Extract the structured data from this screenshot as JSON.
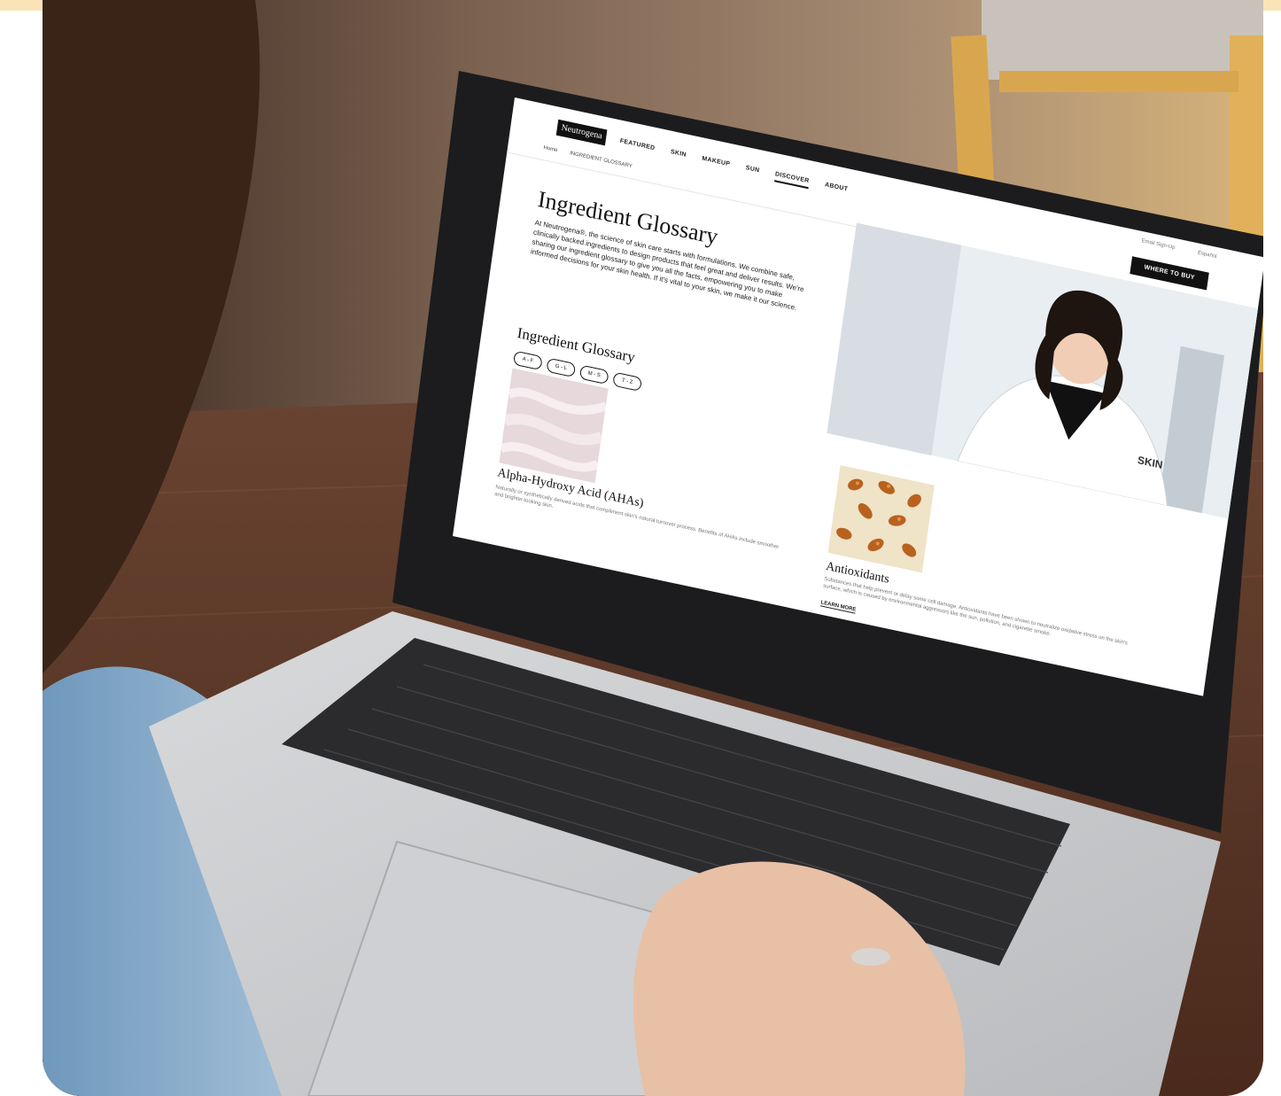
{
  "colors": {
    "accent_band": "#fbe3b8",
    "screen_background": "#ffffff",
    "button": "#111111"
  },
  "site": {
    "logo": "Neutrogena",
    "nav": [
      "FEATURED",
      "SKIN",
      "MAKEUP",
      "SUN",
      "DISCOVER",
      "ABOUT"
    ],
    "active_nav": "DISCOVER",
    "utility_links": [
      "Email Sign-Up",
      "Español"
    ],
    "cta": "WHERE TO BUY",
    "breadcrumb": [
      "Home",
      "INGREDIENT GLOSSARY"
    ]
  },
  "page": {
    "title": "Ingredient Glossary",
    "intro": "At Neutrogena®, the science of skin care starts with formulations. We combine safe, clinically backed ingredients to design products that feel great and deliver results. We're sharing our ingredient glossary to give you all the facts, empowering you to make informed decisions for your skin health. If it's vital to your skin, we make it our science.",
    "hero_image": "scientist-photo",
    "hero_badge": "SKIN"
  },
  "glossary": {
    "heading": "Ingredient Glossary",
    "filters": [
      "A - F",
      "G - L",
      "M - S",
      "T - Z"
    ],
    "entries": [
      {
        "title": "Alpha-Hydroxy Acid (AHAs)",
        "description": "Naturally or synthetically derived acids that compliment skin's natural turnover process. Benefits of AHAs include smoother and brighter-looking skin.",
        "image": "cream-texture-photo"
      },
      {
        "title": "Antioxidants",
        "description": "Substances that help prevent or delay some cell damage. Antioxidants have been shown to neutralize oxidative stress on the skin's surface, which is caused by environmental aggressors like the sun, pollution, and cigarette smoke.",
        "link": "LEARN MORE",
        "image": "capsules-photo"
      }
    ]
  }
}
